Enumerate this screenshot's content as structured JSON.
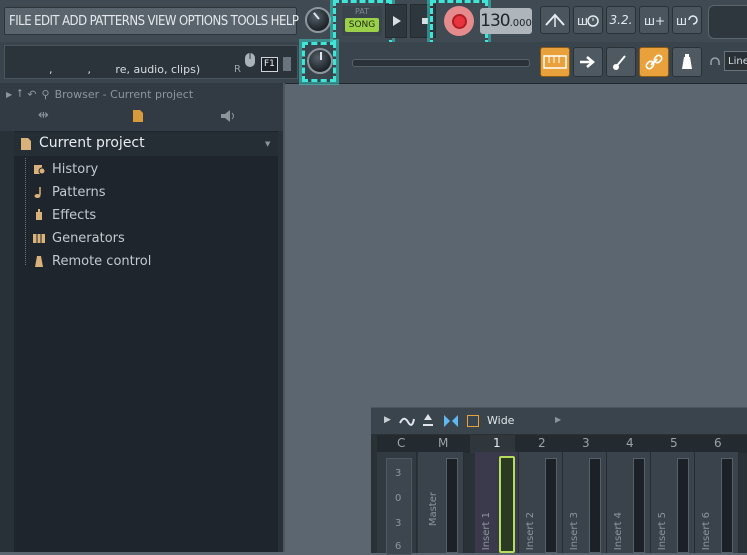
{
  "menu": [
    "FILE",
    "EDIT",
    "ADD",
    "PATTERNS",
    "VIEW",
    "OPTIONS",
    "TOOLS",
    "HELP"
  ],
  "transport": {
    "pat_label": "PAT",
    "song_label": "SONG",
    "tempo": "130",
    "tempo_decimal": ".000"
  },
  "hint_bar": {
    "text": ",          ,       re, audio, clips)",
    "r_label": "R",
    "f1_label": "F1"
  },
  "toolbar_right": {
    "countdown_label": "3.2.",
    "line_label": "Line"
  },
  "browser": {
    "title": "Browser - Current project",
    "root": "Current project",
    "items": [
      {
        "label": "History",
        "icon": "history-icon"
      },
      {
        "label": "Patterns",
        "icon": "note-icon"
      },
      {
        "label": "Effects",
        "icon": "effects-plug-icon"
      },
      {
        "label": "Generators",
        "icon": "keyboard-icon"
      },
      {
        "label": "Remote control",
        "icon": "remote-control-icon"
      }
    ]
  },
  "mixer": {
    "view_label": "Wide",
    "columns": [
      "C",
      "M",
      "1",
      "2",
      "3",
      "4",
      "5",
      "6"
    ],
    "scale": [
      "3",
      "0",
      "3",
      "6"
    ],
    "master_label": "Master",
    "inserts": [
      "Insert 1",
      "Insert 2",
      "Insert 3",
      "Insert 4",
      "Insert 5",
      "Insert 6"
    ]
  },
  "colors": {
    "highlight": "#3ee6d8",
    "song_green": "#9bd04b",
    "record_red": "#e8343c",
    "accent_orange": "#e9a23b"
  }
}
